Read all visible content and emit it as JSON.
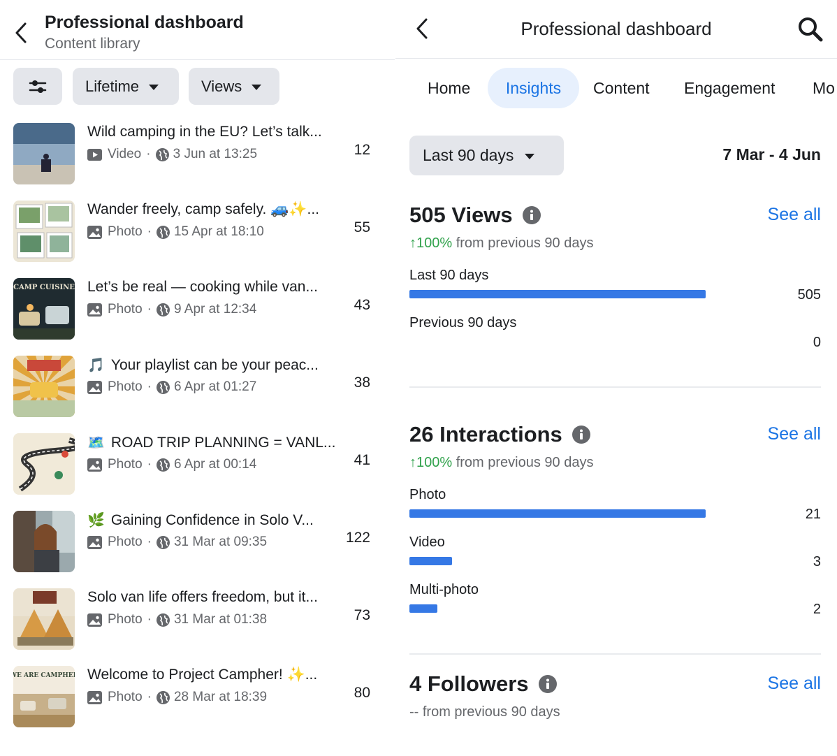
{
  "left": {
    "header": {
      "title": "Professional dashboard",
      "subtitle": "Content library"
    },
    "filters": {
      "period": "Lifetime",
      "metric": "Views"
    },
    "posts": [
      {
        "title": "Wild camping in the EU? Let’s talk...",
        "emoji": "",
        "type": "Video",
        "date": "3 Jun at 13:25",
        "value": "12",
        "thumb": "lake-chair"
      },
      {
        "title": "Wander freely, camp safely. 🚙✨...",
        "emoji": "",
        "type": "Photo",
        "date": "15 Apr at 18:10",
        "value": "55",
        "thumb": "collage"
      },
      {
        "title": "Let’s be real — cooking while van...",
        "emoji": "",
        "type": "Photo",
        "date": "9 Apr at 12:34",
        "value": "43",
        "thumb": "camp-cuisine"
      },
      {
        "title": "Your playlist can be your peac...",
        "emoji": "🎵",
        "type": "Photo",
        "date": "6 Apr at 01:27",
        "value": "38",
        "thumb": "distress"
      },
      {
        "title": "ROAD TRIP PLANNING = VANL...",
        "emoji": "🗺️",
        "type": "Photo",
        "date": "6 Apr at 00:14",
        "value": "41",
        "thumb": "road-trip"
      },
      {
        "title": "Gaining Confidence in Solo V...",
        "emoji": "🌿",
        "type": "Photo",
        "date": "31 Mar at 09:35",
        "value": "122",
        "thumb": "woman"
      },
      {
        "title": "Solo van life offers freedom, but it...",
        "emoji": "",
        "type": "Photo",
        "date": "31 Mar at 01:38",
        "value": "73",
        "thumb": "tents"
      },
      {
        "title": "Welcome to Project Campher! ✨...",
        "emoji": "",
        "type": "Photo",
        "date": "28 Mar at 18:39",
        "value": "80",
        "thumb": "we-are-campher"
      }
    ]
  },
  "right": {
    "header": {
      "title": "Professional dashboard"
    },
    "tabs": [
      "Home",
      "Insights",
      "Content",
      "Engagement",
      "Mo"
    ],
    "active_tab": "Insights",
    "range_label": "Last 90 days",
    "date_range": "7 Mar - 4 Jun",
    "see_all": "See all",
    "views": {
      "title": "505 Views",
      "delta_pct": "100%",
      "delta_text": " from previous 90 days",
      "rows": [
        {
          "label": "Last 90 days",
          "value": "505",
          "fraction": 1.0
        },
        {
          "label": "Previous 90 days",
          "value": "0",
          "fraction": 0.0
        }
      ]
    },
    "interactions": {
      "title": "26 Interactions",
      "delta_pct": "100%",
      "delta_text": " from previous 90 days",
      "rows": [
        {
          "label": "Photo",
          "value": "21",
          "fraction": 1.0
        },
        {
          "label": "Video",
          "value": "3",
          "fraction": 0.143
        },
        {
          "label": "Multi-photo",
          "value": "2",
          "fraction": 0.095
        }
      ]
    },
    "followers": {
      "title": "4 Followers",
      "delta_text": "-- from previous 90 days"
    }
  },
  "colors": {
    "accent": "#1b74e4",
    "bar": "#3578e5",
    "positive": "#31a24c",
    "chip_bg": "#e4e6eb",
    "tab_active_bg": "#e7f0fd"
  }
}
